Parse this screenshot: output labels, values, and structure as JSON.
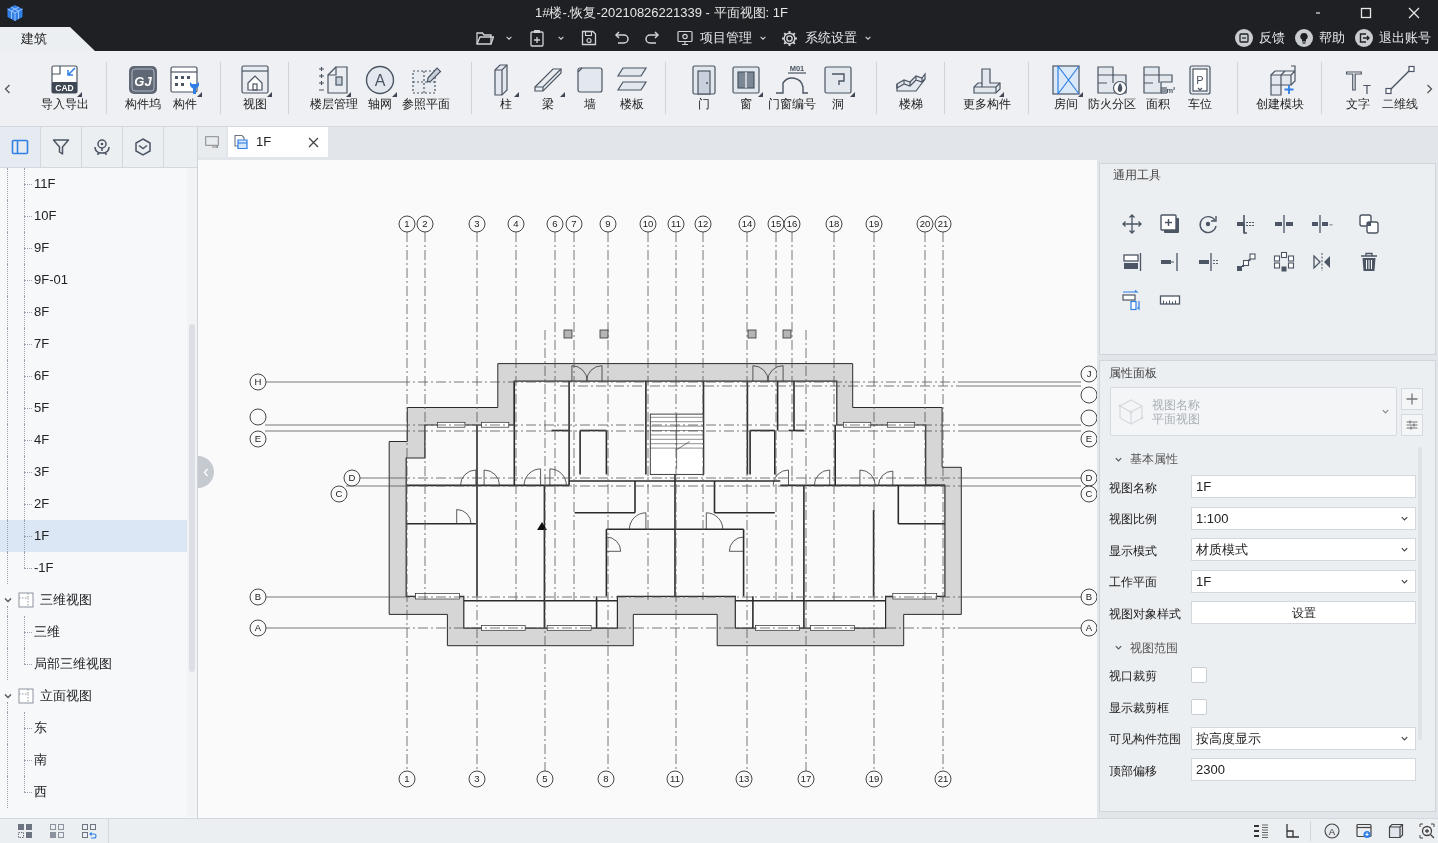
{
  "window": {
    "title": "1#楼-.恢复-20210826221339 - 平面视图: 1F"
  },
  "ribbon_tabs": [
    {
      "label": "建筑",
      "selected": true
    }
  ],
  "quick_menus": [
    {
      "label": "项目管理"
    },
    {
      "label": "系统设置"
    }
  ],
  "account_links": [
    {
      "label": "反馈"
    },
    {
      "label": "帮助"
    },
    {
      "label": "退出账号"
    }
  ],
  "ribbon_groups": [
    [
      {
        "label": "导入导出",
        "menu": true,
        "icon_text": [
          "CAD"
        ]
      }
    ],
    [
      {
        "label": "构件坞",
        "menu": false,
        "icon_text": [
          "GJ"
        ]
      },
      {
        "label": "构件",
        "menu": true
      }
    ],
    [
      {
        "label": "视图",
        "menu": true
      }
    ],
    [
      {
        "label": "楼层管理",
        "menu": true
      },
      {
        "label": "轴网",
        "menu": true,
        "icon_text": [
          "A"
        ]
      },
      {
        "label": "参照平面",
        "menu": false
      }
    ],
    [
      {
        "label": "柱",
        "menu": true
      },
      {
        "label": "梁",
        "menu": true
      },
      {
        "label": "墙",
        "menu": false
      },
      {
        "label": "楼板",
        "menu": false
      }
    ],
    [
      {
        "label": "门",
        "menu": false
      },
      {
        "label": "窗",
        "menu": true
      },
      {
        "label": "门窗编号",
        "menu": false,
        "icon_text": [
          "M01"
        ]
      },
      {
        "label": "洞",
        "menu": true
      }
    ],
    [
      {
        "label": "楼梯",
        "menu": false
      }
    ],
    [
      {
        "label": "更多构件",
        "menu": true
      }
    ],
    [
      {
        "label": "房间",
        "menu": true
      },
      {
        "label": "防火分区",
        "menu": false
      },
      {
        "label": "面积",
        "menu": false,
        "icon_text": [
          "m²"
        ]
      },
      {
        "label": "车位",
        "menu": false,
        "icon_text": [
          "P"
        ]
      }
    ],
    [
      {
        "label": "创建模块",
        "menu": false
      }
    ],
    [
      {
        "label": "文字",
        "menu": false,
        "icon_text": [
          "T",
          "T"
        ]
      },
      {
        "label": "二维线",
        "menu": false
      }
    ]
  ],
  "left_panel": {
    "tabs": [
      {
        "selected": true
      },
      {
        "selected": false
      },
      {
        "selected": false
      },
      {
        "selected": false
      }
    ]
  },
  "tree": [
    {
      "children": [
        {
          "label": "11F",
          "selected": false
        },
        {
          "label": "10F",
          "selected": false
        },
        {
          "label": "9F",
          "selected": false
        },
        {
          "label": "9F-01",
          "selected": false
        },
        {
          "label": "8F",
          "selected": false
        },
        {
          "label": "7F",
          "selected": false
        },
        {
          "label": "6F",
          "selected": false
        },
        {
          "label": "5F",
          "selected": false
        },
        {
          "label": "4F",
          "selected": false
        },
        {
          "label": "3F",
          "selected": false
        },
        {
          "label": "2F",
          "selected": false
        },
        {
          "label": "1F",
          "selected": true
        },
        {
          "label": "-1F",
          "selected": false
        }
      ]
    },
    {
      "label": "三维视图",
      "selected": false,
      "expanded": true,
      "children": [
        {
          "label": "三维",
          "selected": false
        },
        {
          "label": "局部三维视图",
          "selected": false
        }
      ]
    },
    {
      "label": "立面视图",
      "selected": false,
      "expanded": true,
      "children": [
        {
          "label": "东",
          "selected": false
        },
        {
          "label": "南",
          "selected": false
        },
        {
          "label": "西",
          "selected": false
        }
      ]
    }
  ],
  "document_tabs": [
    {
      "label": "1F",
      "selected": true
    }
  ],
  "floor_plan": {
    "top_axes": [
      "1",
      "2",
      "3",
      "4",
      "6",
      "7",
      "9",
      "10",
      "11",
      "12",
      "14",
      "15",
      "16",
      "18",
      "19",
      "20",
      "21"
    ],
    "bottom_axes": [
      "1",
      "3",
      "5",
      "8",
      "11",
      "13",
      "17",
      "19",
      "21"
    ],
    "left_axes": [
      "H",
      "E",
      "D",
      "C",
      "B",
      "A"
    ],
    "right_axes": [
      "J",
      "E",
      "D",
      "C",
      "B",
      "A"
    ]
  },
  "tools_panel": {
    "title": "通用工具"
  },
  "properties_panel": {
    "title": "属性面板",
    "type_selector": {
      "name": "视图名称",
      "type": "平面视图",
      "disabled": true
    },
    "sections": [
      {
        "title": "基本属性",
        "expanded": true,
        "rows": [
          {
            "kind": "text",
            "label": "视图名称",
            "value": "1F"
          },
          {
            "kind": "select",
            "label": "视图比例",
            "value": "1:100"
          },
          {
            "kind": "select",
            "label": "显示模式",
            "value": "材质模式"
          },
          {
            "kind": "select",
            "label": "工作平面",
            "value": "1F"
          },
          {
            "kind": "button",
            "label": "视图对象样式",
            "value": "设置"
          }
        ]
      },
      {
        "title": "视图范围",
        "expanded": true,
        "rows": [
          {
            "kind": "checkbox",
            "label": "视口裁剪",
            "checked": false
          },
          {
            "kind": "checkbox",
            "label": "显示裁剪框",
            "checked": false
          },
          {
            "kind": "select",
            "label": "可见构件范围",
            "value": "按高度显示"
          },
          {
            "kind": "text",
            "label": "顶部偏移",
            "value": "2300"
          }
        ]
      }
    ]
  },
  "status_bar": {
    "icon_text": "A"
  }
}
